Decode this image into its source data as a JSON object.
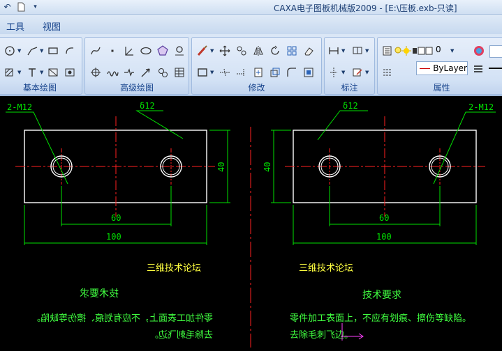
{
  "window": {
    "title": "CAXA电子图板机械版2009 - [E:\\压板.exb-只读]"
  },
  "menu": {
    "tools": "工具",
    "view": "视图"
  },
  "ribbon": {
    "groups": {
      "basic": "基本绘图",
      "advanced": "高级绘图",
      "modify": "修改",
      "dimension": "标注",
      "properties": "属性"
    },
    "layer_name": "0",
    "linetype": "ByLayer"
  },
  "drawing": {
    "left_part": {
      "hole_label": "2-M12",
      "chamfer_label": "δ12",
      "dim_40": "40",
      "dim_60": "60",
      "dim_100": "100",
      "forum": "三维技术论坛",
      "req_title": "技术要求",
      "req_line1": "零件加工表面上，不应有划痕、擦伤等缺陷。",
      "req_line2": "去除毛刺飞边。"
    },
    "right_part": {
      "hole_label": "2-M12",
      "chamfer_label": "δ12",
      "dim_40": "40",
      "dim_60": "60",
      "dim_100": "100",
      "forum": "三维技术论坛",
      "req_title": "技术要求",
      "req_line1": "零件加工表面上，不应有划痕、擦伤等缺陷。",
      "req_line2": "去除毛刺飞边。"
    }
  },
  "colors": {
    "outline": "#ffffff",
    "centerline": "#ff2020",
    "dimension": "#00e000",
    "text_yellow": "#ffff40",
    "text_green": "#40ff40",
    "cursor": "#ff40ff"
  }
}
